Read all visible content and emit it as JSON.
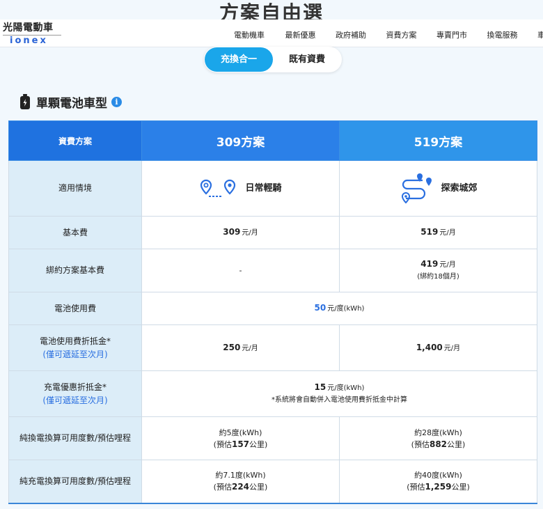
{
  "headline": "方案自由選",
  "brand": {
    "chinese": "光陽電動車",
    "english": "ionex"
  },
  "nav": [
    "電動機車",
    "最新優惠",
    "政府補助",
    "資費方案",
    "專賣門市",
    "換電服務",
    "車主專"
  ],
  "toggle": {
    "active": "充換合一",
    "inactive": "既有資費"
  },
  "section_title": "單顆電池車型",
  "info_glyph": "i",
  "table": {
    "header": {
      "label": "資費方案",
      "plan_a": "309方案",
      "plan_b": "519方案"
    },
    "rows": {
      "scenario": {
        "label": "適用情境",
        "a": "日常輕騎",
        "b": "探索城郊"
      },
      "base_fee": {
        "label": "基本費",
        "a_num": "309",
        "a_unit": "元/月",
        "b_num": "519",
        "b_unit": "元/月"
      },
      "bundle_fee": {
        "label": "綁約方案基本費",
        "a": "-",
        "b_num": "419",
        "b_unit": "元/月",
        "b_note": "(綁約18個月)"
      },
      "battery_fee": {
        "label": "電池使用費",
        "num": "50",
        "unit": "元/度(kWh)"
      },
      "battery_discount": {
        "label": "電池使用費折抵金*",
        "sub": "(僅可遞延至次月)",
        "a_num": "250",
        "a_unit": "元/月",
        "b_num": "1,400",
        "b_unit": "元/月"
      },
      "charge_discount": {
        "label": "充電優惠折抵金*",
        "sub": "(僅可遞延至次月)",
        "num": "15",
        "unit": "元/度(kWh)",
        "note": "*系統將會自動併入電池使用費折抵金中計算"
      },
      "swap_range": {
        "label": "純換電換算可用度數/預估哩程",
        "a_line1": "約5度(kWh)",
        "a_pre": "(預估",
        "a_km": "157",
        "a_post": "公里)",
        "b_line1": "約28度(kWh)",
        "b_pre": "(預估",
        "b_km": "882",
        "b_post": "公里)"
      },
      "charge_range": {
        "label": "純充電換算可用度數/預估哩程",
        "a_line1": "約7.1度(kWh)",
        "a_pre": "(預估",
        "a_km": "224",
        "a_post": "公里)",
        "b_line1": "約40度(kWh)",
        "b_pre": "(預估",
        "b_km": "1,259",
        "b_post": "公里)"
      }
    }
  },
  "colors": {
    "accent": "#1aa6ea",
    "header_blue": "#2b80e8",
    "label_bg": "#dcedf8",
    "link_blue": "#2a6fe0"
  }
}
